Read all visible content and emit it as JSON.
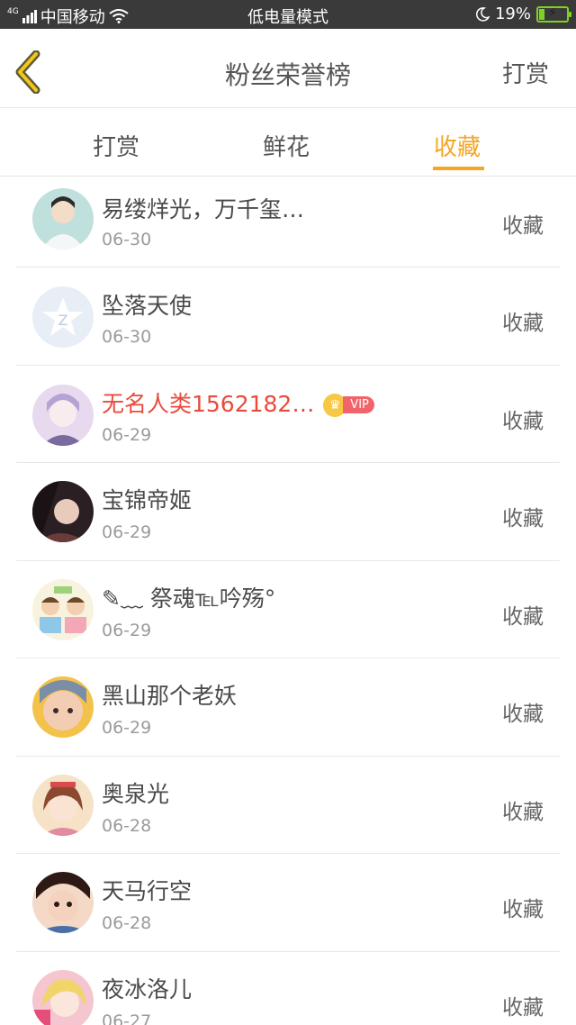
{
  "status_bar": {
    "network": "4G",
    "carrier": "中国移动",
    "mode": "低电量模式",
    "battery_percent": "19%",
    "battery_level": 0.19,
    "accent": "#7ed321"
  },
  "header": {
    "title": "粉丝荣誉榜",
    "action": "打赏",
    "back_icon": "chevron-left-icon"
  },
  "tabs": [
    {
      "label": "打赏",
      "active": false
    },
    {
      "label": "鲜花",
      "active": false
    },
    {
      "label": "收藏",
      "active": true
    }
  ],
  "colors": {
    "accent": "#f5a623",
    "vip_name": "#e94b3c",
    "vip_badge": "#f0646a"
  },
  "fans": [
    {
      "name": "易缕烊光，万千玺…",
      "date": "06-30",
      "action": "收藏"
    },
    {
      "name": "坠落天使",
      "date": "06-30",
      "action": "收藏"
    },
    {
      "name": "无名人类1562182…",
      "date": "06-29",
      "action": "收藏",
      "vip": true,
      "vip_label": "VIP"
    },
    {
      "name": "宝锦帝姬",
      "date": "06-29",
      "action": "收藏"
    },
    {
      "name": "✎﹏ 祭魂℡吟殇°",
      "date": "06-29",
      "action": "收藏"
    },
    {
      "name": "黑山那个老妖",
      "date": "06-29",
      "action": "收藏"
    },
    {
      "name": "奥泉光",
      "date": "06-28",
      "action": "收藏"
    },
    {
      "name": "天马行空",
      "date": "06-28",
      "action": "收藏"
    },
    {
      "name": "夜冰洛儿",
      "date": "06-27",
      "action": "收藏"
    }
  ]
}
